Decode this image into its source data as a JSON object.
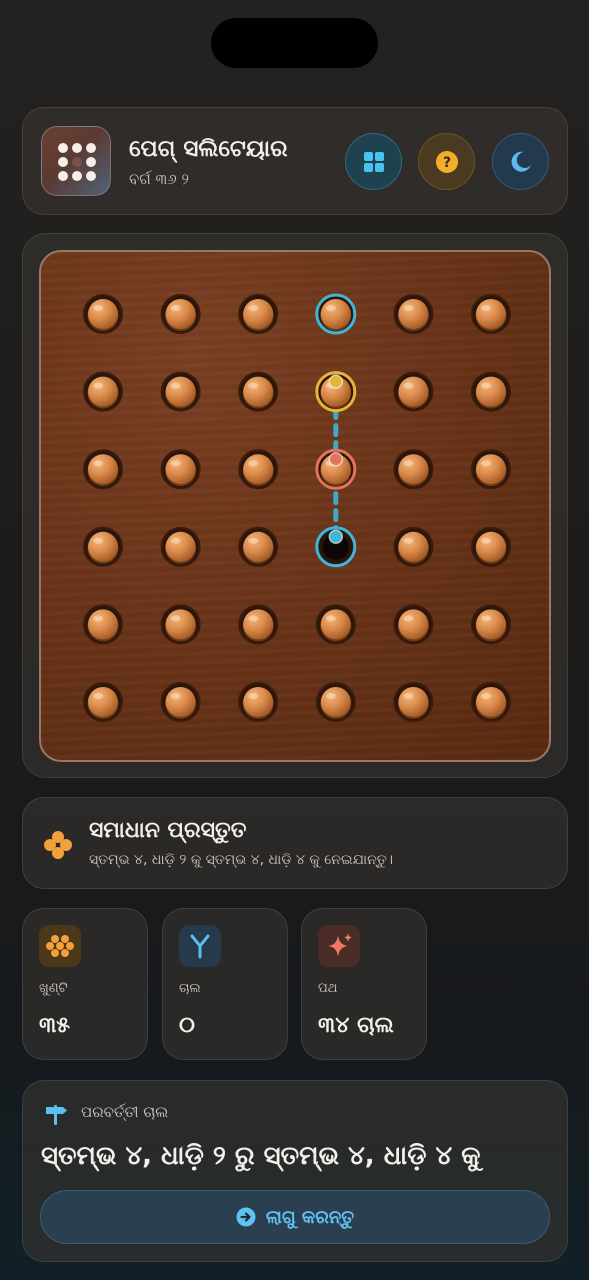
{
  "header": {
    "title": "ପେଗ୍ ସଲିଟେୟାର",
    "subtitle": "ବର୍ଗ ୩୬ ୨",
    "buttons": {
      "layout_icon": "grid-icon",
      "help_icon": "question-icon",
      "theme_icon": "moon-icon"
    }
  },
  "board": {
    "rows": 6,
    "cols": 6,
    "empty_holes": [
      [
        3,
        3
      ]
    ],
    "highlights": {
      "selected": {
        "row": 0,
        "col": 3,
        "color": "#3fb6d8"
      },
      "from": {
        "row": 1,
        "col": 3,
        "color": "#e7b43a"
      },
      "jumped": {
        "row": 2,
        "col": 3,
        "color": "#e2735c"
      },
      "target": {
        "row": 3,
        "col": 3,
        "color": "#3fb6d8"
      }
    }
  },
  "status": {
    "icon": "peg-cluster-icon",
    "title": "ସମାଧାନ ପ୍ରସ୍ତୁତ",
    "description": "ସ୍ତମ୍ଭ ୪, ଧାଡ଼ି ୨ କୁ ସ୍ତମ୍ଭ ୪, ଧାଡ଼ି ୪ କୁ ନେଇଯାନ୍ତୁ।"
  },
  "stats": {
    "pegs": {
      "label": "ଖୁଣ୍ଟି",
      "value": "୩୫"
    },
    "moves": {
      "label": "ଚାଲ",
      "value": "୦"
    },
    "path": {
      "label": "ପଥ",
      "value": "୩୪ ଚାଲ"
    }
  },
  "next": {
    "heading": "ପରବର୍ତ୍ତୀ ଚାଲ",
    "move": "ସ୍ତମ୍ଭ ୪, ଧାଡ଼ି ୨ ରୁ ସ୍ତମ୍ଭ ୪, ଧାଡ଼ି ୪ କୁ",
    "apply_label": "ଲାଗୁ କରନ୍ତୁ"
  },
  "colors": {
    "accent": "#5fc2f0",
    "peg": "#d98a4a",
    "wood": "#6a3419"
  }
}
